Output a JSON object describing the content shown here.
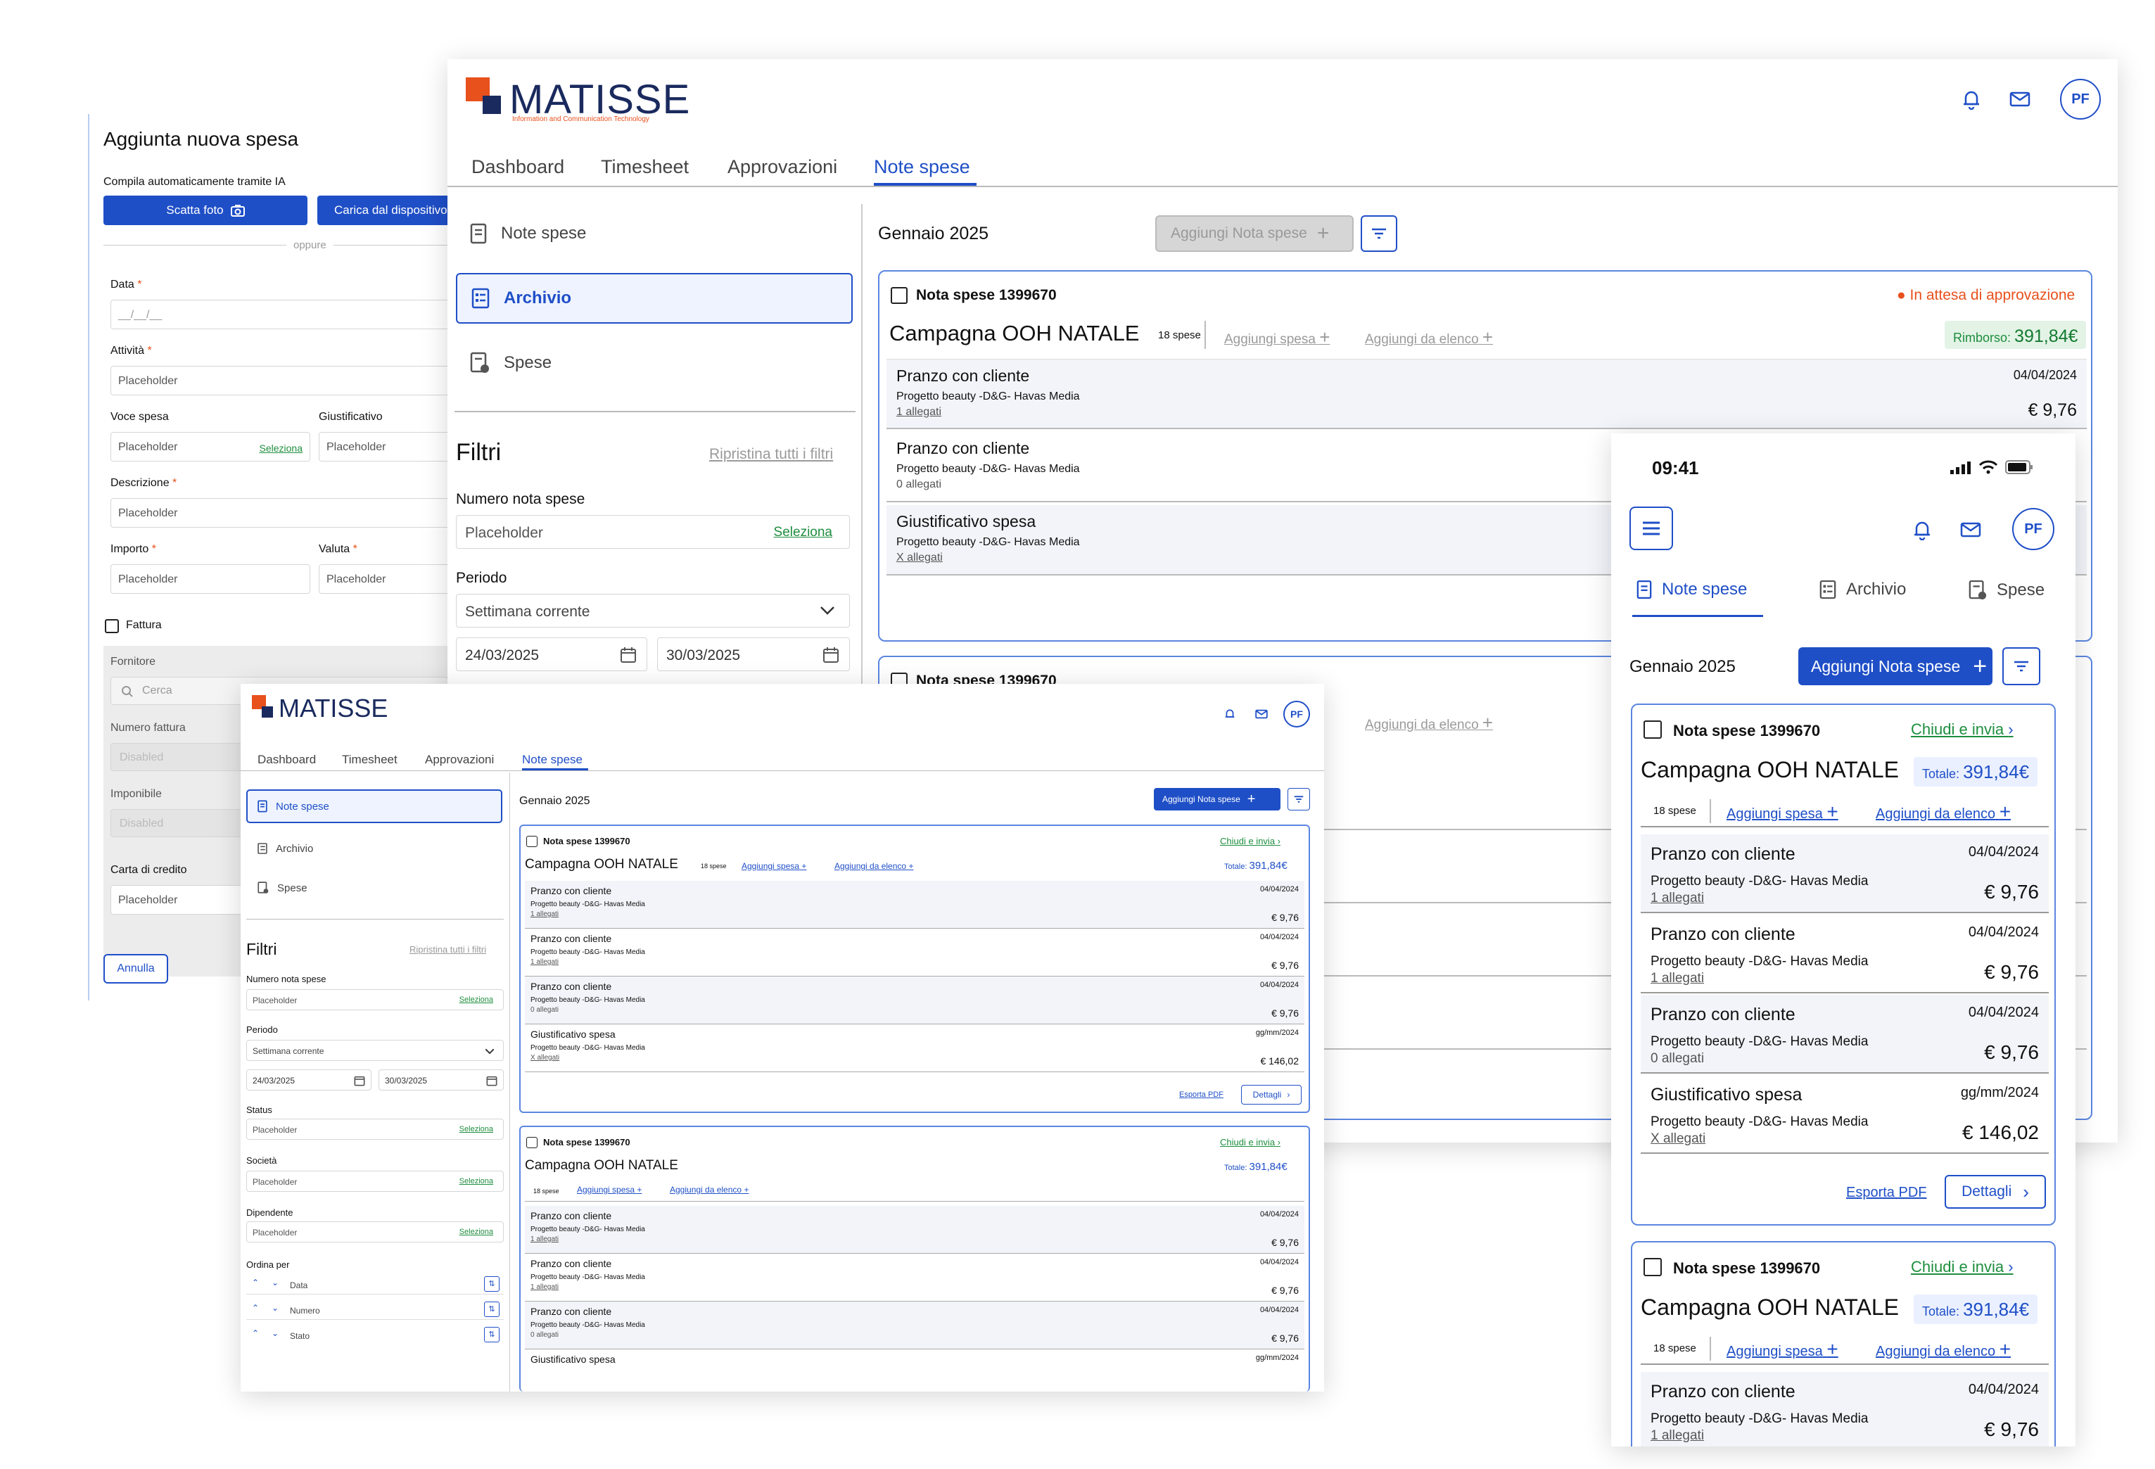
{
  "brand": {
    "name": "MATISSE",
    "tagline": "Information and Communication Technology",
    "colors": {
      "accent": "#1f4fc7",
      "orange": "#e8501c",
      "green": "#1e8e3e",
      "navy": "#1a2a5e"
    }
  },
  "user": {
    "initials": "PF"
  },
  "nav": {
    "tabs": [
      "Dashboard",
      "Timesheet",
      "Approvazioni",
      "Note spese"
    ],
    "active": "Note spese"
  },
  "sidebar": {
    "items": [
      "Note spese",
      "Archivio",
      "Spese"
    ]
  },
  "filters": {
    "title": "Filtri",
    "reset": "Ripristina tutti i filtri",
    "numero_label": "Numero nota spese",
    "placeholder": "Placeholder",
    "select": "Seleziona",
    "periodo_label": "Periodo",
    "periodo_value": "Settimana corrente",
    "date_from": "24/03/2025",
    "date_to": "30/03/2025",
    "status_label": "Status",
    "societa_label": "Società",
    "dipendente_label": "Dipendente",
    "ordina_label": "Ordina per",
    "order_fields": [
      "Data",
      "Numero",
      "Stato"
    ]
  },
  "main": {
    "month": "Gennaio 2025",
    "add_button": "Aggiungi Nota spese"
  },
  "note": {
    "number": "Nota spese 1399670",
    "title": "Campagna OOH NATALE",
    "count": "18 spese",
    "add_expense": "Aggiungi spesa",
    "add_from_list": "Aggiungi da elenco",
    "status": "In attesa di approvazione",
    "refund_label": "Rimborso:",
    "refund_value": "391,84€",
    "close_send": "Chiudi e invia",
    "total_label": "Totale:",
    "total_value": "391,84€",
    "export": "Esporta PDF",
    "details": "Dettagli"
  },
  "expenses": [
    {
      "title": "Pranzo con cliente",
      "project": "Progetto beauty -D&G- Havas Media",
      "attachments": "1 allegati",
      "date": "04/04/2024",
      "amount": "€ 9,76"
    },
    {
      "title": "Pranzo con cliente",
      "project": "Progetto beauty -D&G- Havas Media",
      "attachments": "1 allegati",
      "date": "04/04/2024",
      "amount": "€ 9,76"
    },
    {
      "title": "Pranzo con cliente",
      "project": "Progetto beauty -D&G- Havas Media",
      "attachments": "0 allegati",
      "date": "04/04/2024",
      "amount": "€ 9,76"
    },
    {
      "title": "Giustificativo spesa",
      "project": "Progetto beauty -D&G- Havas Media",
      "attachments": "X allegati",
      "date": "gg/mm/2024",
      "amount": "€ 146,02"
    }
  ],
  "back_expenses": [
    {
      "title": "Pranzo con cliente",
      "project": "Progetto beauty -D&G- Havas Media",
      "attachments": "1 allegati",
      "date": "04/04/2024",
      "amount": "€ 9,76"
    },
    {
      "title": "Pranzo con cliente",
      "project": "Progetto beauty -D&G- Havas Media",
      "attachments": "0 allegati"
    },
    {
      "title": "Giustificativo spesa",
      "project": "Progetto beauty -D&G- Havas Media",
      "attachments": "X allegati"
    }
  ],
  "form": {
    "title": "Aggiunta nuova spesa",
    "ai_label": "Compila automaticamente tramite IA",
    "photo_btn": "Scatta foto",
    "upload_btn": "Carica dal dispositivo",
    "or": "oppure",
    "data_label": "Data",
    "date_placeholder": "__/__/__",
    "attivita_label": "Attività",
    "voce_label": "Voce spesa",
    "giustificativo_label": "Giustificativo",
    "descrizione_label": "Descrizione",
    "importo_label": "Importo",
    "valuta_label": "Valuta",
    "fattura_label": "Fattura",
    "fornitore_label": "Fornitore",
    "search_placeholder": "Cerca",
    "numero_fattura_label": "Numero fattura",
    "disabled": "Disabled",
    "imponibile_label": "Imponibile",
    "carta_label": "Carta di credito",
    "cancel": "Annulla"
  },
  "phone": {
    "time": "09:41"
  }
}
